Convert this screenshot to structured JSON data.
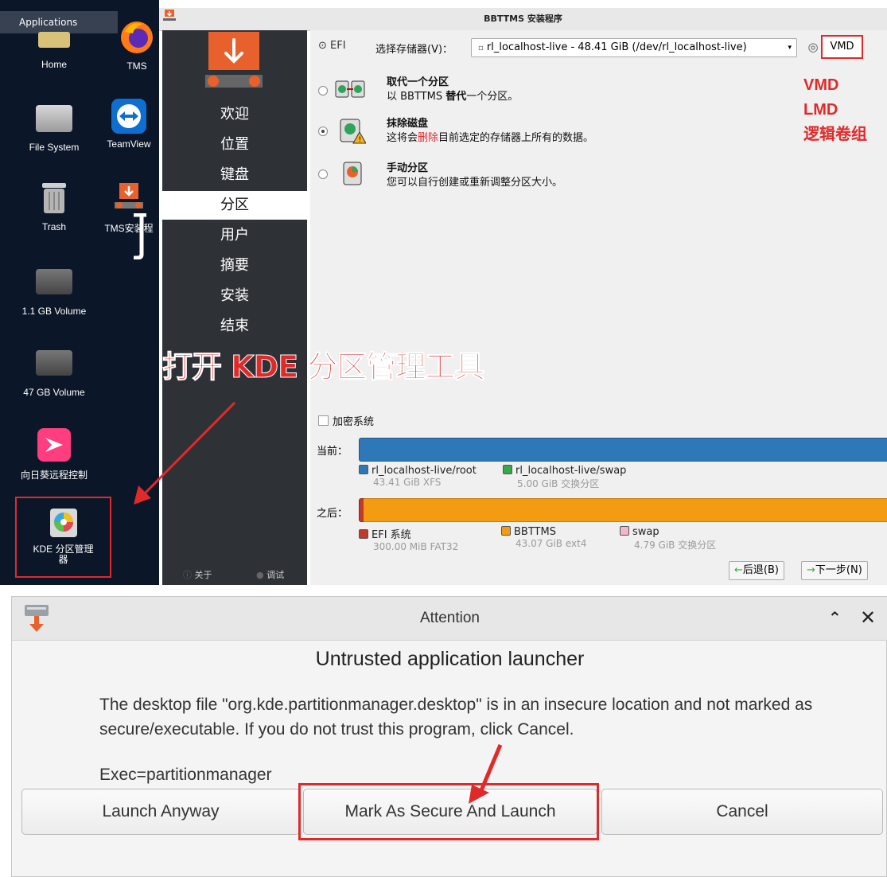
{
  "desktop": {
    "applications_label": "Applications",
    "icons": [
      {
        "label": "Home"
      },
      {
        "label": "TMS"
      },
      {
        "label": "File System"
      },
      {
        "label": "TeamView"
      },
      {
        "label": "Trash"
      },
      {
        "label": "TMS安装程"
      },
      {
        "label": "1.1 GB Volume"
      },
      {
        "label": "47 GB Volume"
      },
      {
        "label": "向日葵远程控制"
      },
      {
        "label": "KDE 分区管理器"
      }
    ]
  },
  "installer": {
    "title": "BBTTMS 安装程序",
    "nav": [
      "欢迎",
      "位置",
      "键盘",
      "分区",
      "用户",
      "摘要",
      "安装",
      "结束"
    ],
    "active_nav": "分区",
    "footer_about": "关于",
    "footer_debug": "调试",
    "efi_label": "EFI",
    "storage_label": "选择存储器(V)：",
    "storage_value": "rl_localhost-live - 48.41 GiB (/dev/rl_localhost-live)",
    "vmd_button": "VMD",
    "options": [
      {
        "title": "取代一个分区",
        "desc_prefix": "以 BBTTMS ",
        "desc_bold": "替代",
        "desc_suffix": "一个分区。"
      },
      {
        "title": "抹除磁盘",
        "desc_prefix": "这将会",
        "desc_red": "删除",
        "desc_suffix": "目前选定的存储器上所有的数据。"
      },
      {
        "title": "手动分区",
        "desc": "您可以自行创建或重新调整分区大小。"
      }
    ],
    "encrypt_label": "加密系统",
    "current_label": "当前：",
    "after_label": "之后：",
    "current_legend": [
      {
        "name": "rl_localhost-live/root",
        "detail": "43.41 GiB  XFS",
        "color": "#2f78b7"
      },
      {
        "name": "rl_localhost-live/swap",
        "detail": "5.00 GiB  交换分区",
        "color": "#38a84a"
      }
    ],
    "after_legend": [
      {
        "name": "EFI 系统",
        "detail": "300.00 MiB  FAT32",
        "color": "#c0392b"
      },
      {
        "name": "BBTTMS",
        "detail": "43.07 GiB  ext4",
        "color": "#f39c12"
      },
      {
        "name": "swap",
        "detail": "4.79 GiB  交换分区",
        "color": "#f0b8c8"
      }
    ],
    "back_button": "后退(B)",
    "next_button": "下一步(N)"
  },
  "annotations": {
    "side_note_lines": [
      "VMD",
      "LMD",
      "逻辑卷组"
    ],
    "headline": "打开 KDE 分区管理工具",
    "color": "#e02a2a"
  },
  "dialog": {
    "title": "Attention",
    "heading": "Untrusted application launcher",
    "message": "The desktop file \"org.kde.partitionmanager.desktop\" is in an insecure location and not marked as secure/executable. If you do not trust this program, click Cancel.",
    "exec_line": "Exec=partitionmanager",
    "buttons": [
      "Launch Anyway",
      "Mark As Secure And Launch",
      "Cancel"
    ]
  }
}
